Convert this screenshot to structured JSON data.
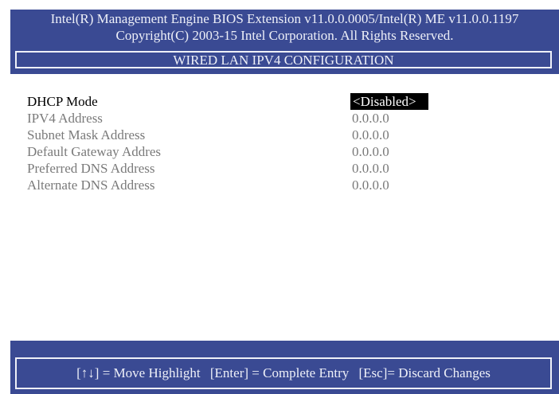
{
  "header": {
    "line1": "Intel(R) Management Engine BIOS Extension v11.0.0.0005/Intel(R) ME v11.0.0.1197",
    "line2": "Copyright(C) 2003-15 Intel Corporation. All Rights Reserved."
  },
  "screen_title": "WIRED LAN IPV4 CONFIGURATION",
  "settings": [
    {
      "label": "DHCP Mode",
      "value": "<Disabled>",
      "selected": true
    },
    {
      "label": "IPV4 Address",
      "value": "0.0.0.0",
      "selected": false
    },
    {
      "label": "Subnet Mask Address",
      "value": "0.0.0.0",
      "selected": false
    },
    {
      "label": "Default Gateway Addres",
      "value": "0.0.0.0",
      "selected": false
    },
    {
      "label": "Preferred DNS Address",
      "value": "0.0.0.0",
      "selected": false
    },
    {
      "label": "Alternate DNS Address",
      "value": "0.0.0.0",
      "selected": false
    }
  ],
  "footer": {
    "move_hint": "[↑↓] = Move Highlight",
    "enter_hint": "[Enter] = Complete Entry",
    "esc_hint": "[Esc]= Discard Changes"
  },
  "colors": {
    "screen_background": "#3a4a93",
    "header_text": "#eef0f8",
    "content_background": "#ffffff",
    "inactive_text": "#7a7a7a",
    "active_text": "#000000",
    "selected_value_background": "#000000",
    "selected_value_text": "#ffffff"
  }
}
